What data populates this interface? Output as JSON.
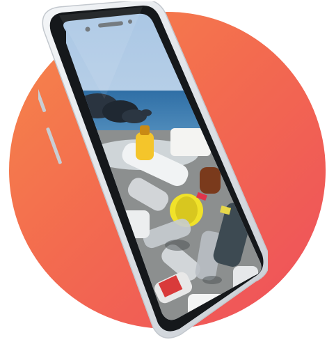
{
  "scene": {
    "background_circle_colors": [
      "#f6874a",
      "#f36b4f",
      "#ee4f5c"
    ],
    "phone_frame_color": "#e9ecef",
    "screen_content": "plastic-bottles-beach-photo",
    "sky_color": "#bcd3e8",
    "sea_color": "#3d7fb3"
  }
}
